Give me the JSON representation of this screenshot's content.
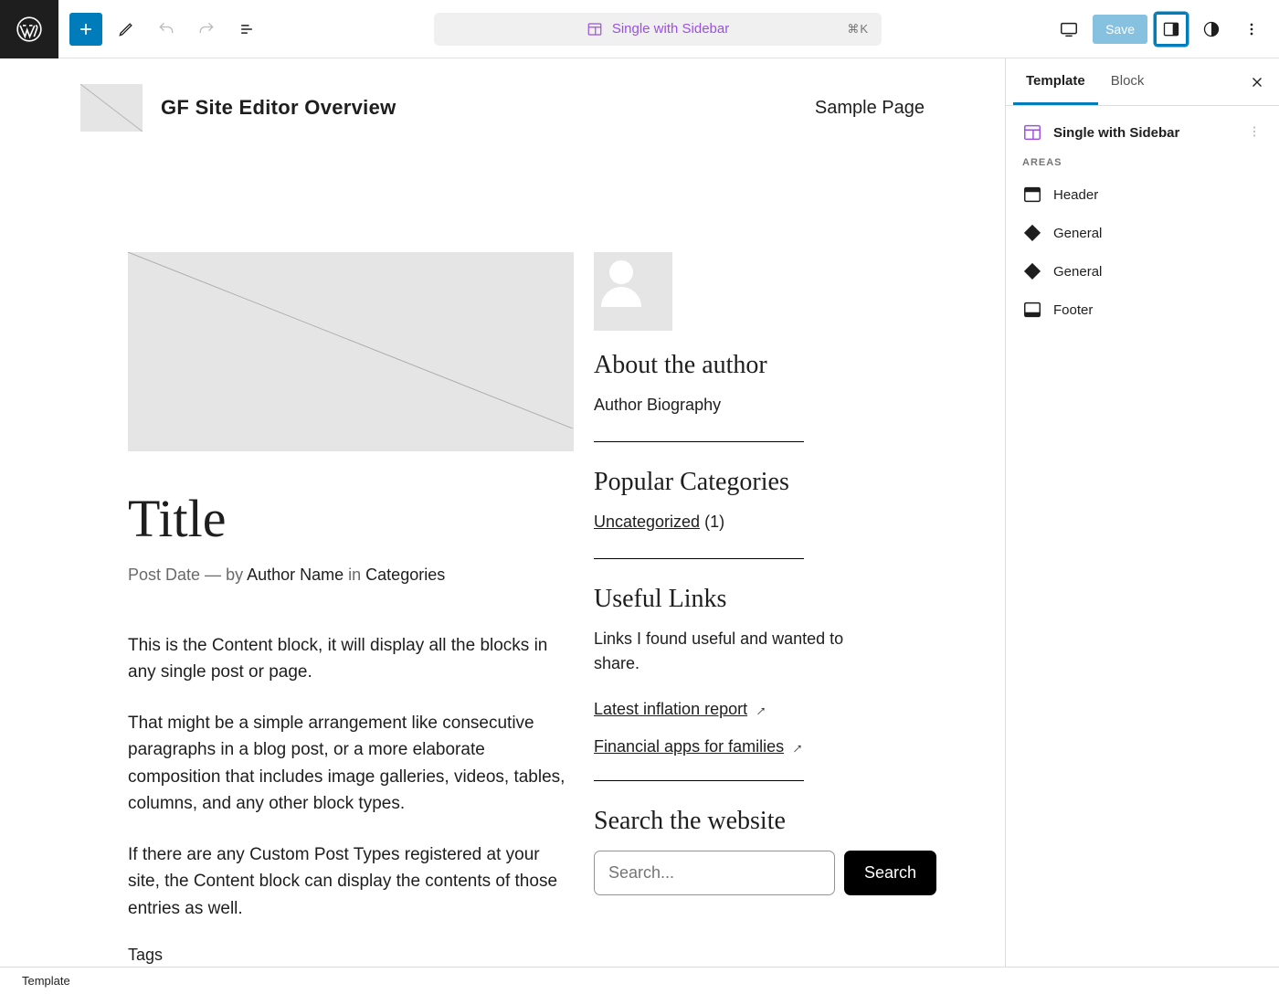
{
  "toolbar": {
    "save_label": "Save",
    "shortcut": "⌘K"
  },
  "document": {
    "template_name": "Single with Sidebar"
  },
  "site_header": {
    "title": "GF Site Editor Overview",
    "nav_item": "Sample Page"
  },
  "post": {
    "title": "Title",
    "meta_date": "Post Date",
    "meta_sep": " — ",
    "meta_by": "by ",
    "meta_author": "Author Name",
    "meta_in": " in ",
    "meta_cat": "Categories",
    "p1": "This is the Content block, it will display all the blocks in any single post or page.",
    "p2": "That might be a simple arrangement like consecutive paragraphs in a blog post, or a more elaborate composition that includes image galleries, videos, tables, columns, and any other block types.",
    "p3": "If there are any Custom Post Types registered at your site, the Content block can display the contents of those entries as well.",
    "tags": "Tags"
  },
  "sidebar": {
    "about_h": "About the author",
    "about_bio": "Author Biography",
    "cats_h": "Popular Categories",
    "cat1": "Uncategorized",
    "cat1_count": " (1)",
    "links_h": "Useful Links",
    "links_desc": "Links I found useful and wanted to share.",
    "link1": "Latest inflation report",
    "link2": "Financial apps for families",
    "search_h": "Search the website",
    "search_placeholder": "Search...",
    "search_btn": "Search"
  },
  "panel": {
    "tab_template": "Template",
    "tab_block": "Block",
    "tpl_name": "Single with Sidebar",
    "areas_label": "Areas",
    "areas": {
      "a1": "Header",
      "a2": "General",
      "a3": "General",
      "a4": "Footer"
    }
  },
  "breadcrumb": "Template"
}
